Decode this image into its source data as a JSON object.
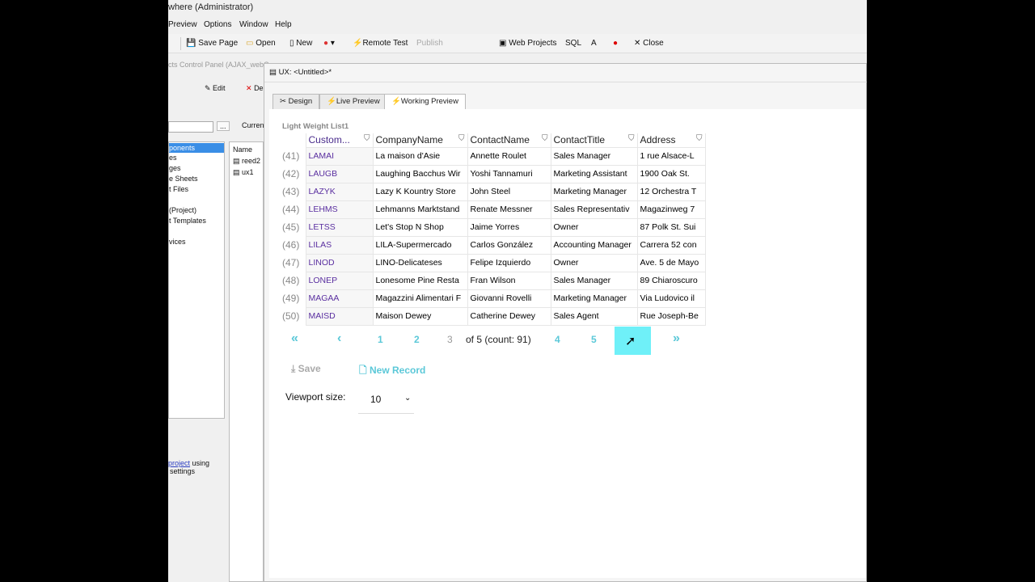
{
  "window": {
    "title": "where (Administrator)"
  },
  "menu": [
    "Preview",
    "Options",
    "Window",
    "Help"
  ],
  "toolbar": {
    "save_page": "Save Page",
    "open": "Open",
    "new": "New",
    "remote_test": "Remote Test",
    "publish": "Publish",
    "web_projects": "Web Projects",
    "sql": "SQL",
    "close": "Close"
  },
  "left_panel": {
    "title": "cts Control Panel (AJAX_webC",
    "edit": "Edit",
    "delete": "De",
    "current": "Curren",
    "browse": "...",
    "tree": [
      "ponents",
      "es",
      "ges",
      "e Sheets",
      "t Files",
      "(Project)",
      "t Templates",
      "vices"
    ],
    "name_header": "Name",
    "files": [
      "reed2",
      "ux1"
    ],
    "footer_link": "project",
    "footer_text1": "using",
    "footer_text2": "settings"
  },
  "ux": {
    "title": "UX: <Untitled>*",
    "tabs": [
      "Design",
      "Live Preview",
      "Working Preview"
    ],
    "active_tab": "Working Preview"
  },
  "list": {
    "title": "Light Weight List1",
    "columns": [
      "Custom...",
      "CompanyName",
      "ContactName",
      "ContactTitle",
      "Address"
    ],
    "rows": [
      [
        "(41)",
        "LAMAI",
        "La maison d'Asie",
        "Annette Roulet",
        "Sales Manager",
        "1 rue Alsace-L"
      ],
      [
        "(42)",
        "LAUGB",
        "Laughing Bacchus Wir",
        "Yoshi Tannamuri",
        "Marketing Assistant",
        "1900 Oak St."
      ],
      [
        "(43)",
        "LAZYK",
        "Lazy K Kountry Store",
        "John Steel",
        "Marketing Manager",
        "12 Orchestra T"
      ],
      [
        "(44)",
        "LEHMS",
        "Lehmanns Marktstand",
        "Renate Messner",
        "Sales Representativ",
        "Magazinweg 7"
      ],
      [
        "(45)",
        "LETSS",
        "Let's Stop N Shop",
        "Jaime Yorres",
        "Owner",
        "87 Polk St. Sui"
      ],
      [
        "(46)",
        "LILAS",
        "LILA-Supermercado",
        "Carlos González",
        "Accounting Manager",
        "Carrera 52 con"
      ],
      [
        "(47)",
        "LINOD",
        "LINO-Delicateses",
        "Felipe Izquierdo",
        "Owner",
        "Ave. 5 de Mayo"
      ],
      [
        "(48)",
        "LONEP",
        "Lonesome Pine Resta",
        "Fran Wilson",
        "Sales Manager",
        "89 Chiaroscuro"
      ],
      [
        "(49)",
        "MAGAA",
        "Magazzini Alimentari F",
        "Giovanni Rovelli",
        "Marketing Manager",
        "Via Ludovico il"
      ],
      [
        "(50)",
        "MAISD",
        "Maison Dewey",
        "Catherine Dewey",
        "Sales Agent",
        "Rue Joseph-Be"
      ]
    ]
  },
  "pager": {
    "first": "«",
    "prev": "‹",
    "pages": [
      "1",
      "2",
      "3",
      "4",
      "5"
    ],
    "current": "3",
    "summary": "of 5 (count: 91)",
    "next": "›",
    "last": "»"
  },
  "actions": {
    "save": "Save",
    "new_record": "New Record"
  },
  "viewport": {
    "label": "Viewport size:",
    "value": "10"
  },
  "colors": {
    "accent": "#5bc8d8",
    "hover": "#6ff0f8",
    "id_text": "#5a2fa0"
  }
}
